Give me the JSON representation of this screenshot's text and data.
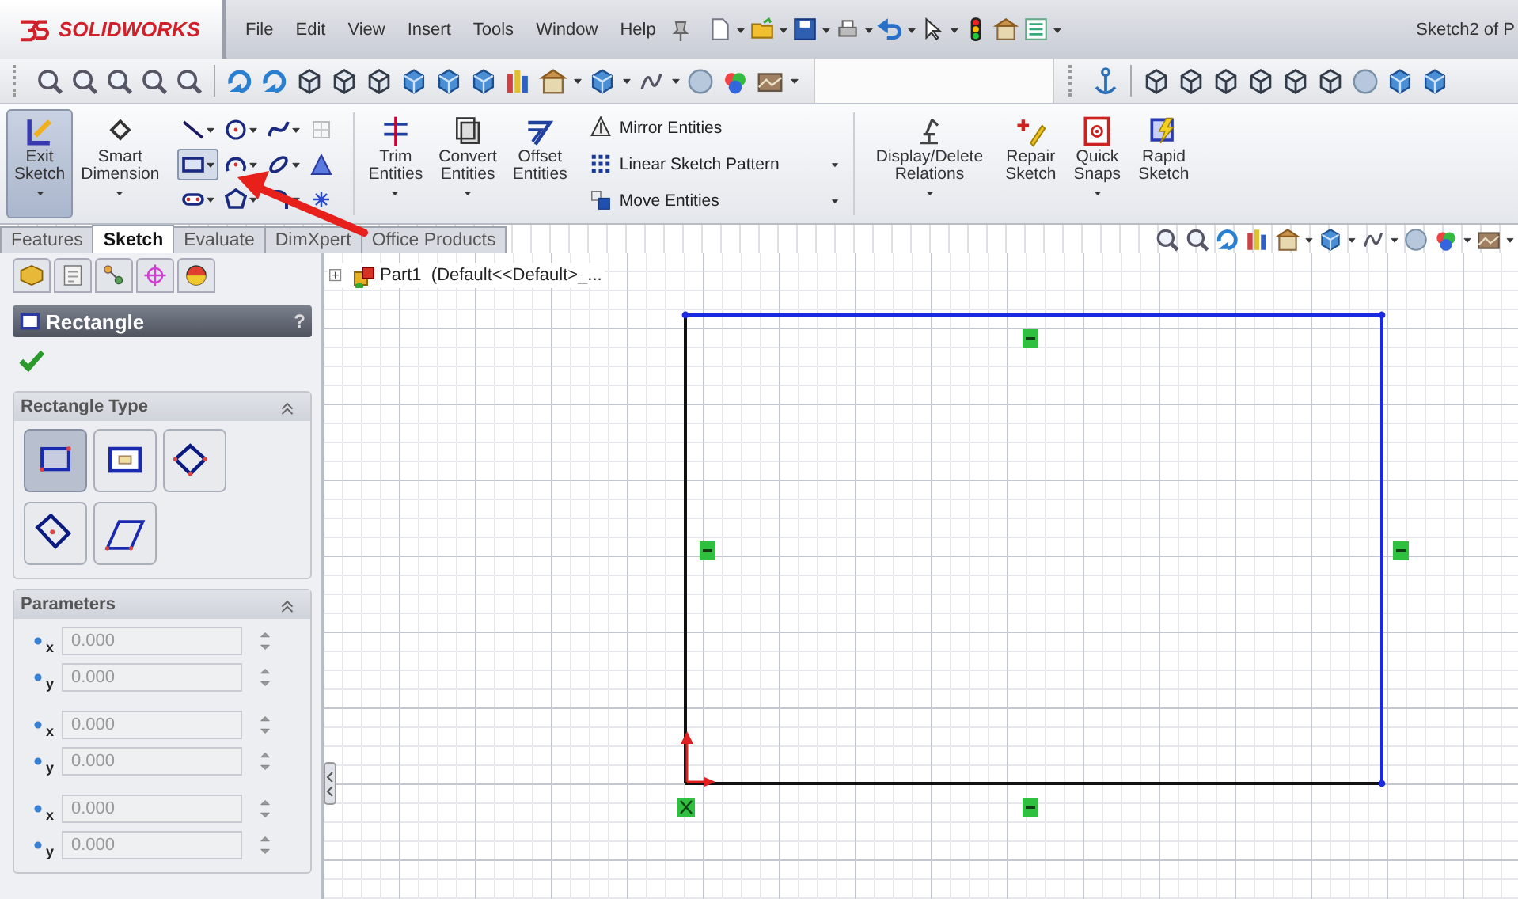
{
  "title_bar": {
    "logo": "SOLIDWORKS",
    "menu": [
      {
        "label": "File"
      },
      {
        "label": "Edit"
      },
      {
        "label": "View"
      },
      {
        "label": "Insert"
      },
      {
        "label": "Tools"
      },
      {
        "label": "Window"
      },
      {
        "label": "Help"
      }
    ],
    "document_title": "Sketch2 of P"
  },
  "ribbon": {
    "left": [
      {
        "label_lines": [
          "Exit",
          "Sketch"
        ],
        "selected": true,
        "dropdown": true
      },
      {
        "label_lines": [
          "Smart",
          "Dimension"
        ],
        "selected": false,
        "dropdown": true
      }
    ],
    "sketch_tools": [
      {
        "selected": false,
        "dropdown": true
      },
      {
        "selected": false,
        "dropdown": true
      },
      {
        "selected": false,
        "dropdown": true
      },
      {
        "selected": false,
        "dropdown": false
      },
      {
        "selected": true,
        "dropdown": true
      },
      {
        "selected": false,
        "dropdown": true
      },
      {
        "selected": false,
        "dropdown": true
      },
      {
        "selected": false,
        "dropdown": false
      },
      {
        "selected": false,
        "dropdown": true
      },
      {
        "selected": false,
        "dropdown": true
      },
      {
        "selected": false,
        "dropdown": true
      },
      {
        "selected": false,
        "dropdown": false
      }
    ],
    "edit": [
      {
        "label_lines": [
          "Trim",
          "Entities"
        ],
        "dropdown": true
      },
      {
        "label_lines": [
          "Convert",
          "Entities"
        ],
        "dropdown": true
      },
      {
        "label_lines": [
          "Offset",
          "Entities"
        ],
        "dropdown": false
      }
    ],
    "pattern": [
      {
        "label": "Mirror Entities",
        "dropdown": false
      },
      {
        "label": "Linear Sketch Pattern",
        "dropdown": true
      },
      {
        "label": "Move Entities",
        "dropdown": true
      }
    ],
    "right": [
      {
        "label_lines": [
          "Display/Delete",
          "Relations"
        ],
        "dropdown": true
      },
      {
        "label_lines": [
          "Repair",
          "Sketch"
        ],
        "dropdown": false
      },
      {
        "label_lines": [
          "Quick",
          "Snaps"
        ],
        "dropdown": true
      },
      {
        "label_lines": [
          "Rapid",
          "Sketch"
        ],
        "dropdown": false
      }
    ]
  },
  "tabs": [
    {
      "label": "Features",
      "selected": false
    },
    {
      "label": "Sketch",
      "selected": true
    },
    {
      "label": "Evaluate",
      "selected": false
    },
    {
      "label": "DimXpert",
      "selected": false
    },
    {
      "label": "Office Products",
      "selected": false
    }
  ],
  "property_manager": {
    "title": "Rectangle",
    "help": "?",
    "rectangle_type": {
      "title": "Rectangle Type",
      "types": [
        {
          "selected": true
        },
        {
          "selected": false
        },
        {
          "selected": false
        },
        {
          "selected": false
        },
        {
          "selected": false
        }
      ]
    },
    "parameters": {
      "title": "Parameters",
      "fields": [
        {
          "axis": "x",
          "value": "0.000"
        },
        {
          "axis": "y",
          "value": "0.000"
        },
        {
          "axis": "x",
          "value": "0.000"
        },
        {
          "axis": "y",
          "value": "0.000"
        },
        {
          "axis": "x",
          "value": "0.000"
        },
        {
          "axis": "y",
          "value": "0.000"
        }
      ]
    }
  },
  "canvas": {
    "tree_label": "Part1  (Default<<Default>_..."
  }
}
